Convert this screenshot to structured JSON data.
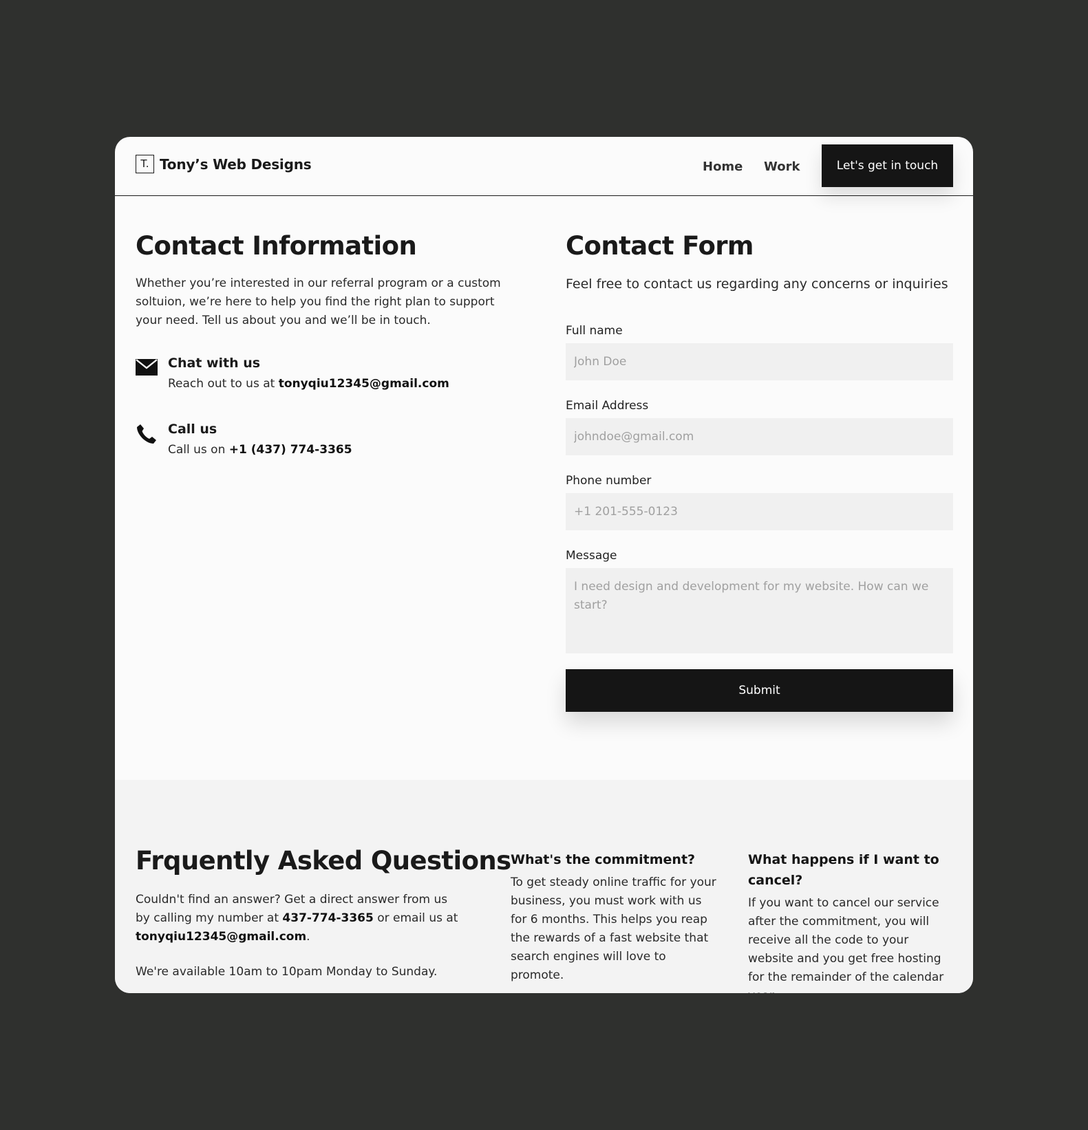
{
  "header": {
    "logo_mark": "T.",
    "logo_name": "Tony’s Web Designs",
    "nav": [
      "Home",
      "Work"
    ],
    "cta_label": "Let's get in touch"
  },
  "contact_info": {
    "title": "Contact Information",
    "description": "Whether you’re interested in our referral program or a custom soltuion, we’re here to help you find the right plan to support your need. Tell us about you and we’ll be in touch.",
    "chat": {
      "icon": "envelope-icon",
      "title": "Chat with us",
      "prefix": "Reach out to us at ",
      "value": "tonyqiu12345@gmail.com"
    },
    "call": {
      "icon": "phone-icon",
      "title": "Call us",
      "prefix": "Call us on ",
      "value": "+1 (437) 774-3365"
    }
  },
  "contact_form": {
    "title": "Contact Form",
    "subtitle": "Feel free to contact us regarding any concerns or inquiries",
    "fields": {
      "full_name": {
        "label": "Full name",
        "placeholder": "John Doe"
      },
      "email": {
        "label": "Email Address",
        "placeholder": "johndoe@gmail.com"
      },
      "phone": {
        "label": "Phone number",
        "placeholder": "+1 201-555-0123"
      },
      "message": {
        "label": "Message",
        "placeholder": "I need design and development for my website. How can we start?"
      }
    },
    "submit_label": "Submit"
  },
  "faq": {
    "title": "Frquently Asked Questions",
    "intro_1": "Couldn't find an answer? Get a direct answer from us by calling my number at ",
    "phone": "437-774-3365",
    "intro_2": " or email us at ",
    "email": "tonyqiu12345@gmail.com",
    "intro_3": ".",
    "availability": "We're available 10am to 10pam Monday to Sunday.",
    "questions": [
      {
        "q": "What's the commitment?",
        "a": "To get steady online traffic for your business, you must work with us for 6 months. This helps you reap the rewards of a fast website that search engines will love to promote."
      },
      {
        "q": "What happens if I want to cancel?",
        "a": "If you want to cancel our service after the commitment, you will receive all the code to your website and you get free hosting for the remainder of the calendar year."
      }
    ]
  }
}
